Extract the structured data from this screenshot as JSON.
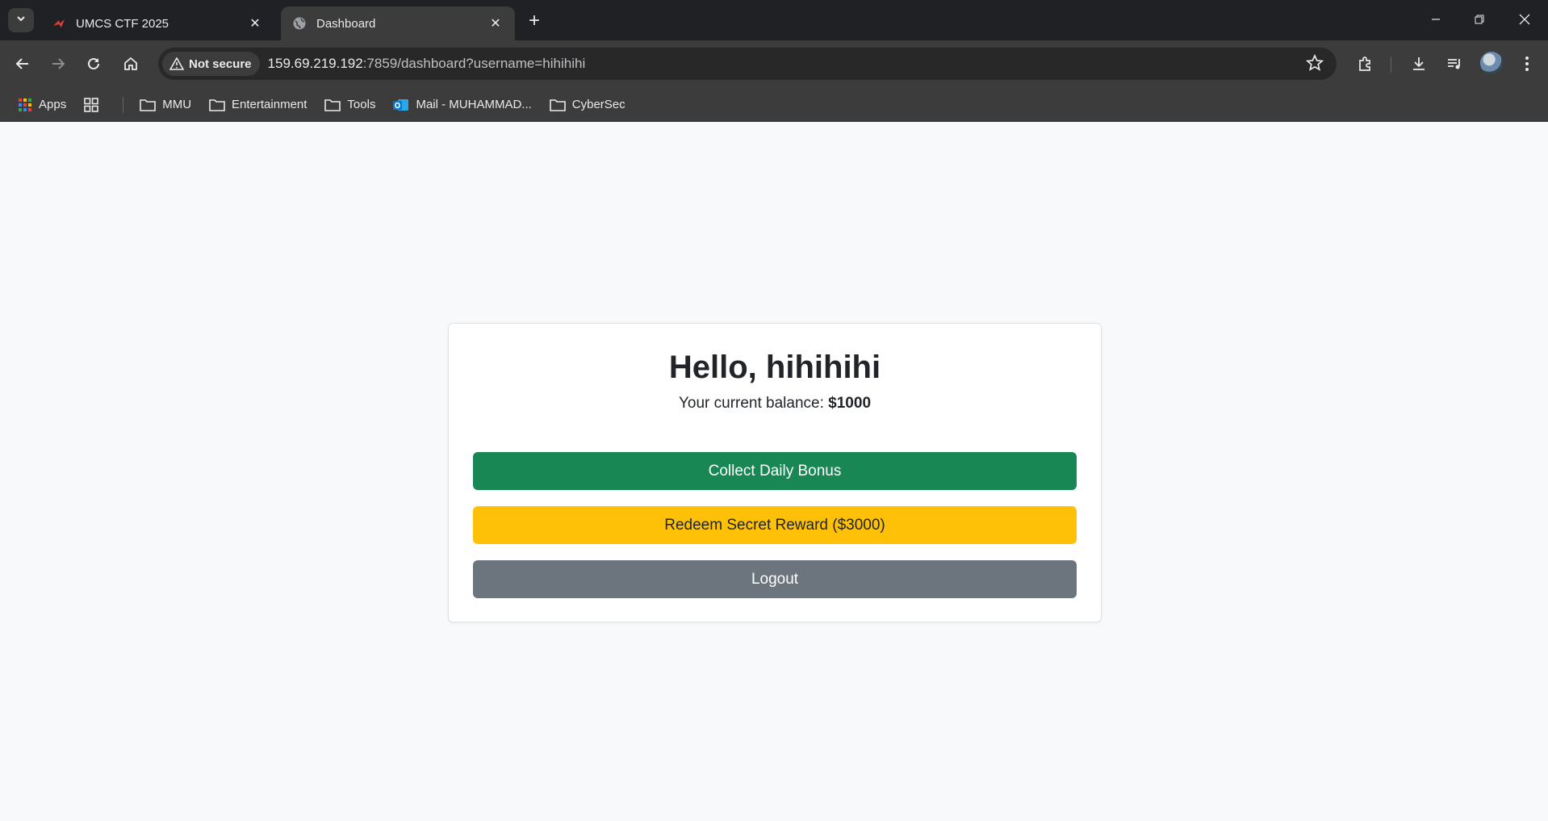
{
  "browser": {
    "tabs": [
      {
        "title": "UMCS CTF 2025",
        "active": false,
        "icon": "umcs-favicon-icon"
      },
      {
        "title": "Dashboard",
        "active": true,
        "icon": "globe-icon"
      }
    ],
    "security_label": "Not secure",
    "url_host": "159.69.219.192",
    "url_rest": ":7859/dashboard?username=hihihihi",
    "bookmarks": [
      {
        "label": "Apps",
        "icon": "apps-grid-icon"
      },
      {
        "label": "MMU",
        "icon": "folder-icon"
      },
      {
        "label": "Entertainment",
        "icon": "folder-icon"
      },
      {
        "label": "Tools",
        "icon": "folder-icon"
      },
      {
        "label": "Mail - MUHAMMAD...",
        "icon": "outlook-icon"
      },
      {
        "label": "CyberSec",
        "icon": "folder-icon"
      }
    ]
  },
  "dashboard": {
    "greeting": "Hello, hihihihi",
    "balance_label": "Your current balance: ",
    "balance_value": "$1000",
    "buttons": {
      "bonus": "Collect Daily Bonus",
      "redeem": "Redeem Secret Reward ($3000)",
      "logout": "Logout"
    }
  },
  "colors": {
    "success": "#198754",
    "warning": "#ffc107",
    "secondary": "#6c757d",
    "chrome_dark": "#202124",
    "chrome_toolbar": "#3c3c3c"
  }
}
